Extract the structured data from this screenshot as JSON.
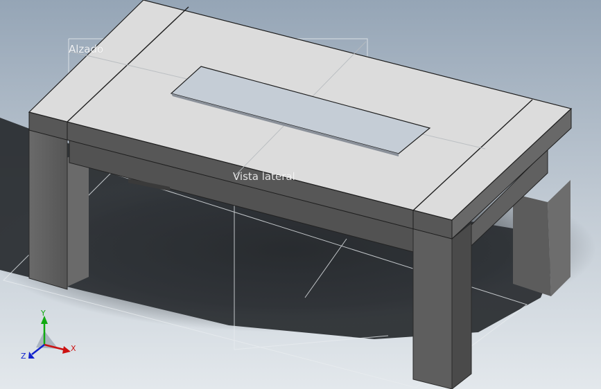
{
  "viewport": {
    "background_top": "#9aa9b8",
    "background_bottom": "#dfe5ea"
  },
  "planes": {
    "front_label": "Alzado",
    "side_label": "Vista lateral"
  },
  "triad": {
    "x_label": "X",
    "y_label": "Y",
    "z_label": "Z",
    "x_color": "#cc1111",
    "y_color": "#11aa11",
    "z_color": "#1122cc"
  },
  "model": {
    "top_color": "#dcdcdc",
    "side_color": "#5a5a5a",
    "front_color": "#4d4d4d",
    "glass_color": "#c5cdd6"
  }
}
